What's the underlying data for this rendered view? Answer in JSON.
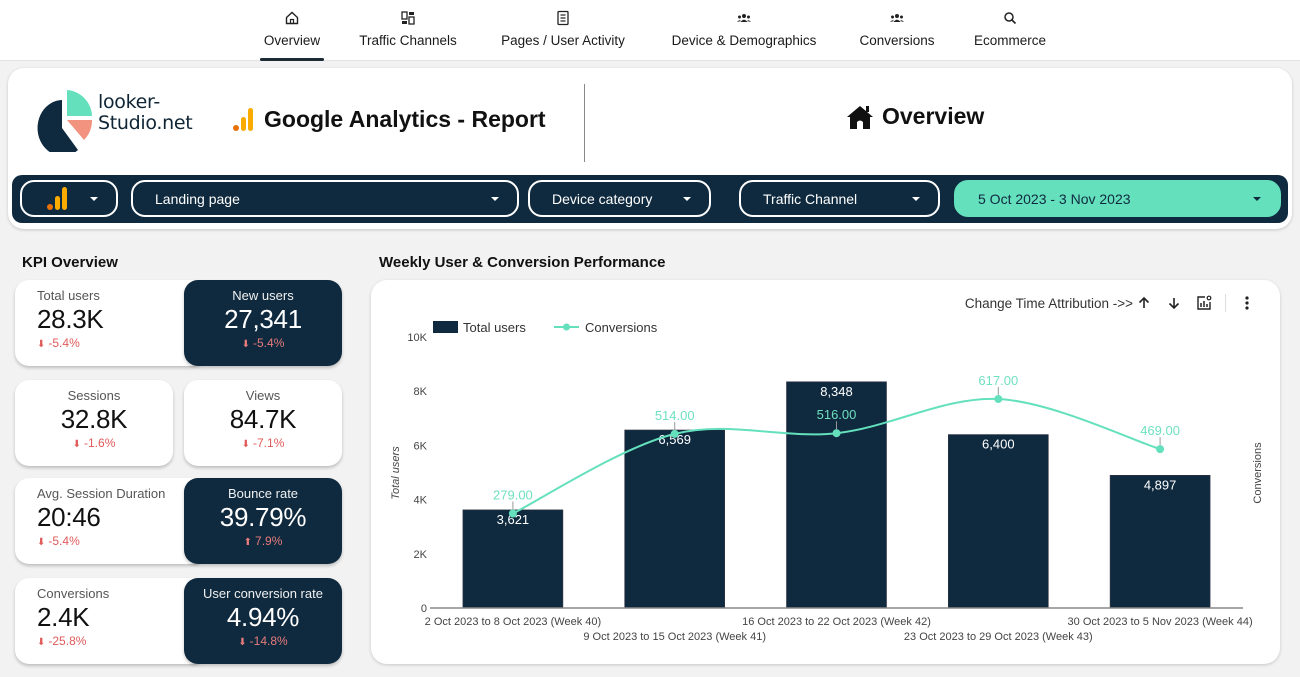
{
  "nav": {
    "items": [
      {
        "label": "Overview",
        "icon": "home-icon",
        "active": true
      },
      {
        "label": "Traffic Channels",
        "icon": "dashboard-icon",
        "active": false
      },
      {
        "label": "Pages / User Activity",
        "icon": "document-icon",
        "active": false
      },
      {
        "label": "Device & Demographics",
        "icon": "group-icon",
        "active": false
      },
      {
        "label": "Conversions",
        "icon": "group-icon",
        "active": false
      },
      {
        "label": "Ecommerce",
        "icon": "search-icon",
        "active": false
      }
    ]
  },
  "header": {
    "logo_line1": "looker-",
    "logo_line2": "Studio.net",
    "report_title": "Google Analytics - Report",
    "page_title": "Overview"
  },
  "filters": {
    "account_selector": "analytics-icon",
    "landing_page": "Landing page",
    "device_category": "Device category",
    "traffic_channel": "Traffic Channel",
    "date_range": "5 Oct 2023 - 3 Nov 2023"
  },
  "kpi": {
    "title": "KPI Overview",
    "cards": [
      {
        "label": "Total users",
        "value": "28.3K",
        "change": "-5.4%",
        "direction": "down"
      },
      {
        "label": "New users",
        "value": "27,341",
        "change": "-5.4%",
        "direction": "down"
      },
      {
        "label": "Sessions",
        "value": "32.8K",
        "change": "-1.6%",
        "direction": "down"
      },
      {
        "label": "Views",
        "value": "84.7K",
        "change": "-7.1%",
        "direction": "down"
      },
      {
        "label": "Avg. Session Duration",
        "value": "20:46",
        "change": "-5.4%",
        "direction": "down"
      },
      {
        "label": "Bounce rate",
        "value": "39.79%",
        "change": "7.9%",
        "direction": "up"
      },
      {
        "label": "Conversions",
        "value": "2.4K",
        "change": "-25.8%",
        "direction": "down"
      },
      {
        "label": "User conversion rate",
        "value": "4.94%",
        "change": "-14.8%",
        "direction": "down"
      }
    ]
  },
  "chart_section": {
    "title": "Weekly User & Conversion Performance",
    "toolbar_label": "Change Time Attribution ->>"
  },
  "colors": {
    "navy": "#0f2a3f",
    "mint": "#64e0bd",
    "negative": "#e05a5a"
  },
  "chart_data": {
    "type": "bar",
    "title": "Weekly User & Conversion Performance",
    "categories": [
      "2 Oct 2023 to 8 Oct 2023 (Week 40)",
      "9 Oct 2023 to 15 Oct 2023 (Week 41)",
      "16 Oct 2023 to 22 Oct 2023 (Week 42)",
      "23 Oct 2023 to 29 Oct 2023 (Week 43)",
      "30 Oct 2023 to 5 Nov 2023 (Week 44)"
    ],
    "series": [
      {
        "name": "Total users",
        "type": "bar",
        "axis": "left",
        "values": [
          3621,
          6569,
          8348,
          6400,
          4897
        ],
        "labels": [
          "3,621",
          "6,569",
          "8,348",
          "6,400",
          "4,897"
        ]
      },
      {
        "name": "Conversions",
        "type": "line",
        "axis": "right",
        "values": [
          279,
          514,
          516,
          617,
          469
        ],
        "labels": [
          "279.00",
          "514.00",
          "516.00",
          "617.00",
          "469.00"
        ]
      }
    ],
    "ylabel": "Total users",
    "ylabel_right": "Conversions",
    "ylim": [
      0,
      10000
    ],
    "yticks": [
      0,
      2000,
      4000,
      6000,
      8000,
      10000
    ],
    "ytick_labels": [
      "0",
      "2K",
      "4K",
      "6K",
      "8K",
      "10K"
    ],
    "ylim_right": [
      0,
      800
    ],
    "legend": [
      "Total users",
      "Conversions"
    ],
    "legend_position": "top-left",
    "grid": false
  }
}
